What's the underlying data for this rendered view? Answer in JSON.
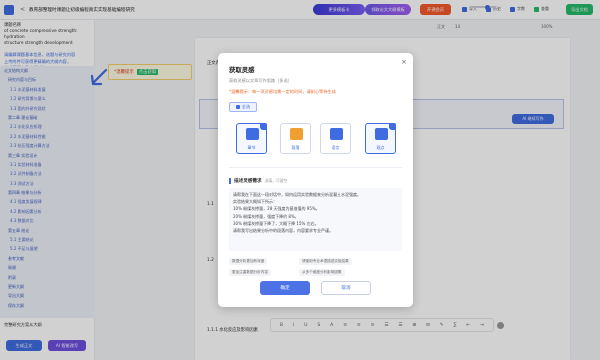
{
  "topbar": {
    "back": "<",
    "title": "教育部整理时课题让初级编程真实实现基础编程研究",
    "promo1": "更多模板卡",
    "promo2": "领取论文大纲模板",
    "vip": "开通会员",
    "actions": [
      {
        "label": "导入",
        "color": "#3f6ce0"
      },
      {
        "label": "历史",
        "color": "#3f6ce0"
      },
      {
        "label": "字数",
        "color": "#3f6ce0"
      },
      {
        "label": "查重",
        "color": "#27b96a"
      }
    ],
    "save": "导出文档"
  },
  "sidebar": {
    "title_lines": [
      "课题名称",
      "of concrete compressive strength: hydration",
      "structure strength development"
    ],
    "desc_lines": [
      "请编辑课题基本信息，选题与研究内容",
      "上传附件可获得更精确的大纲内容，",
      "生成后可查看大纲结构。"
    ],
    "outline": [
      {
        "level": "l1",
        "text": "论文结构大纲"
      },
      {
        "level": "l2",
        "text": "研究内容与目标"
      },
      {
        "level": "l3",
        "text": "1.1  水泥基材料发展"
      },
      {
        "level": "l3",
        "text": "1.2  研究背景与意义"
      },
      {
        "level": "l3",
        "text": "1.3  国内外研究现状"
      },
      {
        "level": "l2",
        "text": "第二章 理论基础"
      },
      {
        "level": "l3",
        "text": "2.1  水化反应机理"
      },
      {
        "level": "l3",
        "text": "2.2  水泥基材料性能"
      },
      {
        "level": "l3",
        "text": "2.3  抗压强度计算方法"
      },
      {
        "level": "l2",
        "text": "第三章 实验设计"
      },
      {
        "level": "l3",
        "text": "3.1  实验材料准备"
      },
      {
        "level": "l3",
        "text": "3.2  试件制备方法"
      },
      {
        "level": "l3",
        "text": "3.3  测试方法"
      },
      {
        "level": "l2",
        "text": "第四章 结果与分析"
      },
      {
        "level": "l3",
        "text": "4.1  强度发展规律"
      },
      {
        "level": "l3",
        "text": "4.2  影响因素分析"
      },
      {
        "level": "l3",
        "text": "4.3  数据对比"
      },
      {
        "level": "l2",
        "text": "第五章 结论"
      },
      {
        "level": "l3",
        "text": "5.1  主要结论"
      },
      {
        "level": "l3",
        "text": "5.2  不足与展望"
      },
      {
        "level": "l2",
        "text": "参考文献"
      },
      {
        "level": "l2",
        "text": "致谢"
      },
      {
        "level": "l2",
        "text": "附录"
      },
      {
        "level": "l2",
        "text": "更新大纲"
      },
      {
        "level": "l2",
        "text": "导出大纲"
      },
      {
        "level": "l2",
        "text": "保存大纲"
      }
    ],
    "bottom_text": "完整研究方案从大纲",
    "btn1": "生成正文",
    "btn2": "AI 智能改写"
  },
  "tip": {
    "text": "*温馨提示",
    "tag": "点击获取"
  },
  "editor": {
    "toolbar": {
      "style": "正文",
      "size": "14",
      "zoom": "100%"
    },
    "headings": [
      {
        "text": "正文内容生成中",
        "x": 0,
        "y": 0
      },
      {
        "text": "1.1",
        "x": 0,
        "y": 0
      },
      {
        "text": "1.2",
        "x": 0,
        "y": 0
      }
    ],
    "section_title": "1.1.1 水化反应及影响因素",
    "float_btn": "AI 继续写作",
    "bottom_heading": "1.3 研究现状分析",
    "bottom_tools": [
      "B",
      "I",
      "U",
      "S",
      "A",
      "≡",
      "≡",
      "≡",
      "☰",
      "☰",
      "⊞",
      "⊟",
      "✎",
      "∑",
      "⇤",
      "⇥"
    ]
  },
  "modal": {
    "title": "获取灵感",
    "close": "×",
    "subtitle": "获取灵感以文章写作思路（多选）",
    "warn": "*温馨提示：每一项灵感均需一定的时间，请耐心等待生成",
    "chip": "全选",
    "cards": [
      {
        "label": "章节",
        "color": "#3f6ce0",
        "selected": true
      },
      {
        "label": "段落",
        "color": "#f0a030",
        "selected": false
      },
      {
        "label": "语言",
        "color": "#3f6ce0",
        "selected": false
      },
      {
        "label": "观点",
        "color": "#3f6ce0",
        "selected": true
      }
    ],
    "section": "描述灵感需求",
    "section_hint": "选填，可留空",
    "text_lines": [
      "请帮我在下面这一段对话中，如何运用实验数据来分析混凝土水泥强度。",
      "实验结果大概如下所示：",
      "10% 粉煤灰掺量，28 天强度为基准值的 95%。",
      "20% 粉煤灰掺量，强度下降约 8%，",
      "30% 粉煤灰掺量下降了，大概下降 15% 左右。",
      "请帮我写出结果分析中的段落内容，内容要求专业严谨。"
    ],
    "chips": [
      "数据分析更加有深度",
      "请使用专业术语描述实验结果",
      "更加注重数据分析内容",
      "从多个维度分析影响因素"
    ],
    "ok": "确定",
    "cancel": "取消"
  }
}
